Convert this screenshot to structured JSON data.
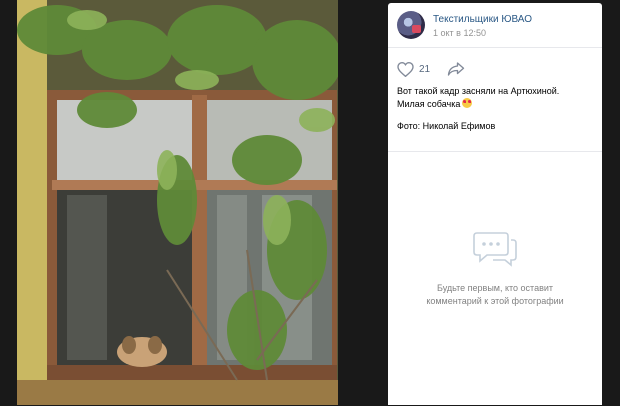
{
  "post": {
    "group_name": "Текстильщики ЮВАО",
    "date": "1 окт в 12:50",
    "likes": "21",
    "caption_line1": "Вот такой кадр засняли на Артюхиной.",
    "caption_line2": "Милая собачка",
    "photo_credit": "Фото: Николай Ефимов"
  },
  "comments": {
    "empty_line1": "Будьте первым, кто оставит",
    "empty_line2": "комментарий к этой фотографии"
  },
  "icons": {
    "like": "heart-icon",
    "share": "share-arrow-icon",
    "comments": "comment-bubbles-icon",
    "emoji": "heart-eyes-emoji-icon"
  },
  "colors": {
    "background": "#191919",
    "link": "#2a5885",
    "muted": "#939393"
  }
}
